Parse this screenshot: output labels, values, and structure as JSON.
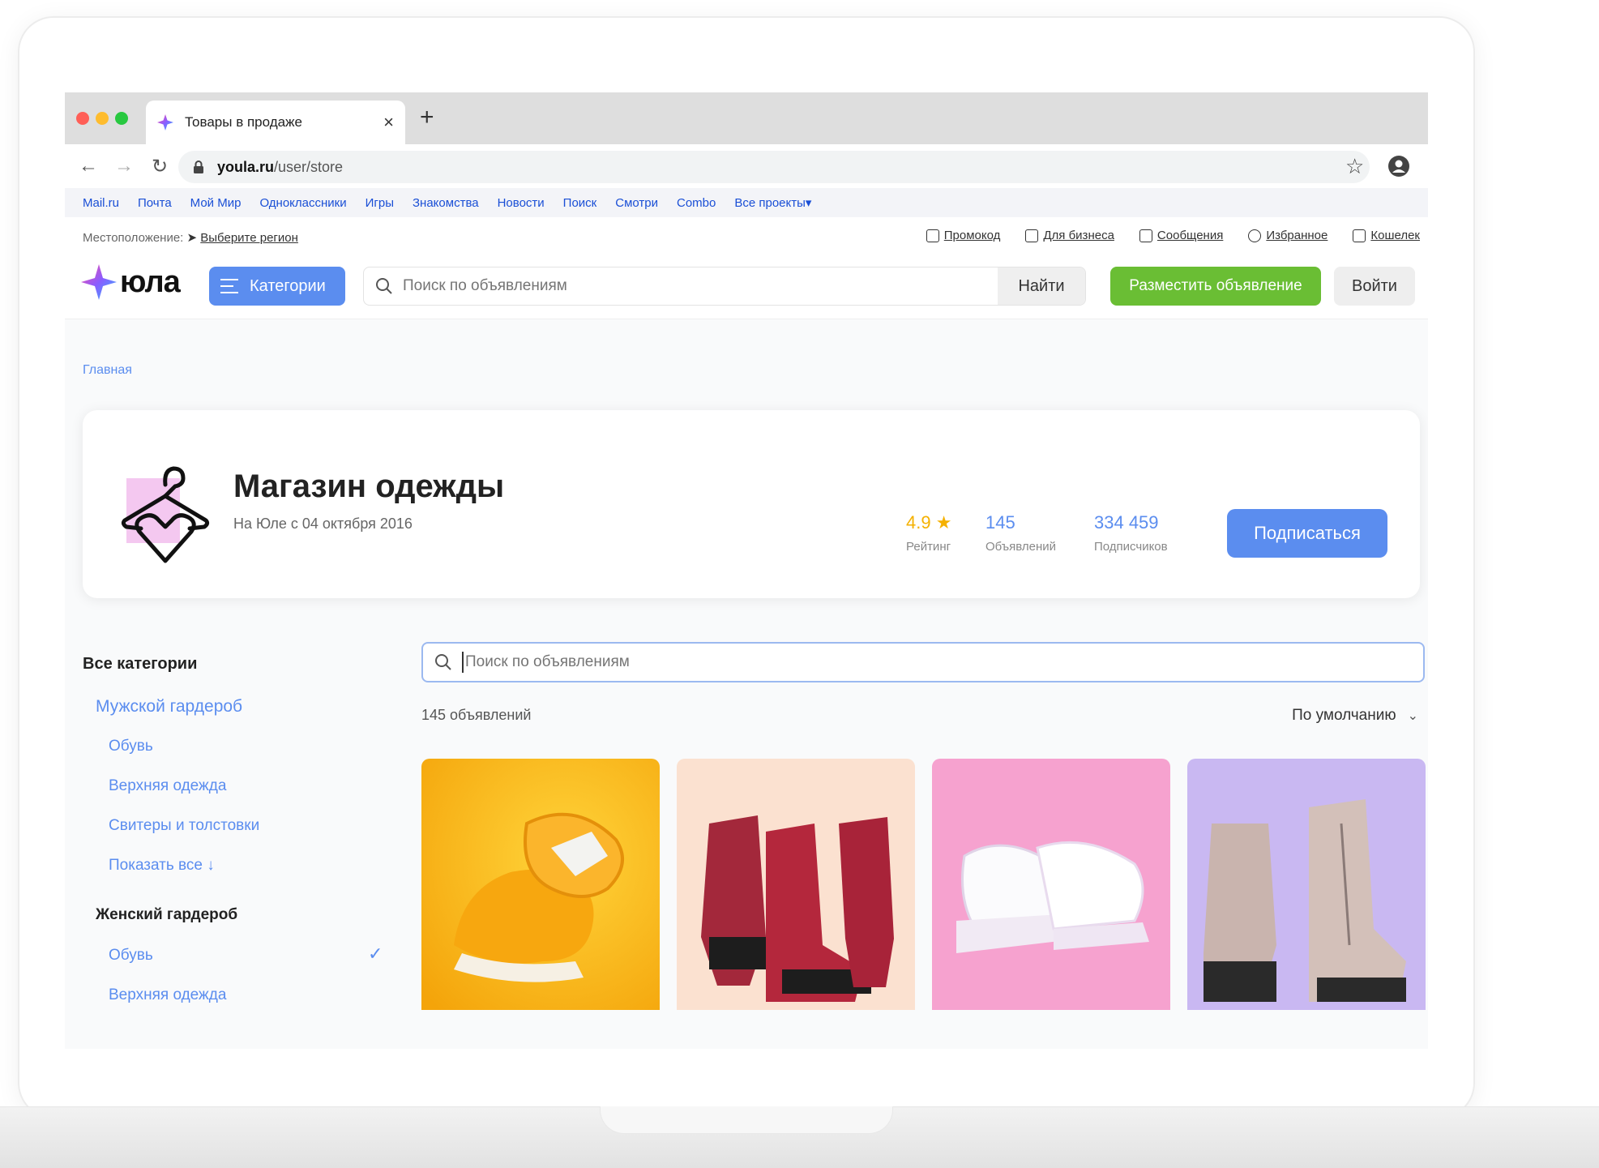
{
  "browser": {
    "tab_title": "Товары в продаже",
    "tab_close": "×",
    "new_tab": "+",
    "url_host": "youla.ru",
    "url_path": "/user/store"
  },
  "portal_links": [
    "Mail.ru",
    "Почта",
    "Мой Мир",
    "Одноклассники",
    "Игры",
    "Знакомства",
    "Новости",
    "Поиск",
    "Смотри",
    "Combo",
    "Все проекты▾"
  ],
  "location": {
    "label": "Местоположение:",
    "link": "Выберите регион"
  },
  "util_links": [
    {
      "label": "Промокод",
      "icon": "gift-icon"
    },
    {
      "label": "Для бизнеса",
      "icon": "briefcase-icon"
    },
    {
      "label": "Сообщения",
      "icon": "message-icon"
    },
    {
      "label": "Избранное",
      "icon": "heart-icon"
    },
    {
      "label": "Кошелек",
      "icon": "wallet-icon"
    }
  ],
  "header": {
    "logo_text": "юла",
    "categories_label": "Категории",
    "search_placeholder": "Поиск по объявлениям",
    "find_label": "Найти",
    "post_label": "Разместить объявление",
    "login_label": "Войти"
  },
  "breadcrumb": "Главная",
  "store": {
    "name": "Магазин одежды",
    "since": "На Юле с 04 октября 2016",
    "rating_value": "4.9 ★",
    "rating_label": "Рейтинг",
    "listings_value": "145",
    "listings_label": "Объявлений",
    "subscribers_value": "334 459",
    "subscribers_label": "Подписчиков",
    "subscribe_label": "Подписаться"
  },
  "sidebar": {
    "heading": "Все категории",
    "men_group": "Мужской гардероб",
    "men_items": [
      "Обувь",
      "Верхняя одежда",
      "Свитеры и толстовки",
      "Показать все ↓"
    ],
    "women_group": "Женский гардероб",
    "women_items": [
      "Обувь",
      "Верхняя одежда"
    ],
    "check": "✓"
  },
  "listings": {
    "search_placeholder": "Поиск по объявлениям",
    "count": "145 объявлений",
    "sort_label": "По умолчанию",
    "sort_chevron": "⌄"
  },
  "colors": {
    "accent_blue": "#5b8def",
    "post_green": "#6abe34",
    "rating_star": "#f5b100"
  }
}
